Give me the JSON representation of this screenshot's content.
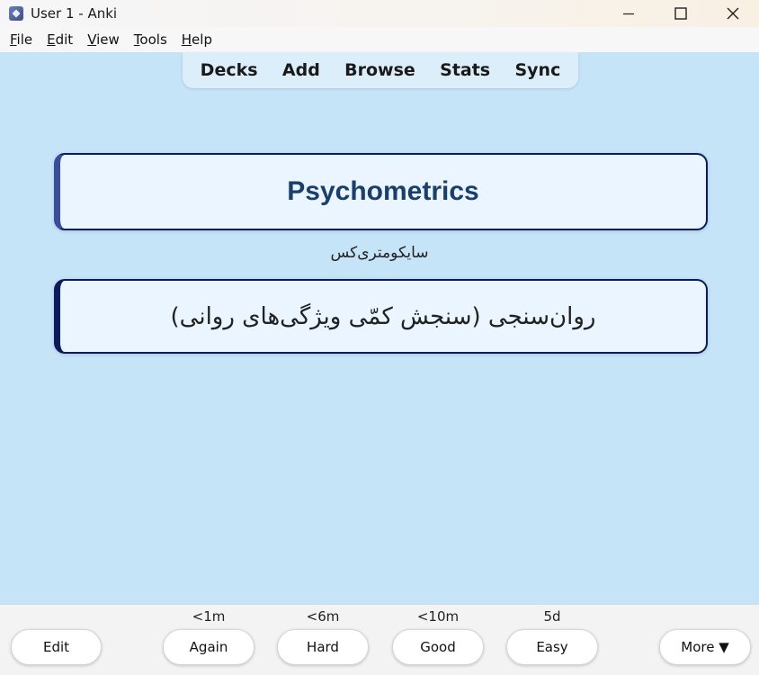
{
  "window": {
    "title": "User 1 - Anki",
    "icon": "anki-star-icon"
  },
  "menu": {
    "items": [
      {
        "label": "File",
        "u": "F",
        "rest": "ile"
      },
      {
        "label": "Edit",
        "u": "E",
        "rest": "dit"
      },
      {
        "label": "View",
        "u": "V",
        "rest": "iew"
      },
      {
        "label": "Tools",
        "u": "T",
        "rest": "ools"
      },
      {
        "label": "Help",
        "u": "H",
        "rest": "elp"
      }
    ]
  },
  "toolbar": {
    "decks": "Decks",
    "add": "Add",
    "browse": "Browse",
    "stats": "Stats",
    "sync": "Sync"
  },
  "card": {
    "front": "Psychometrics",
    "hint": "سایکومتری‌کس",
    "back": "روان‌سنجی (سنجش کمّی ویژگی‌های روانی)"
  },
  "answer": {
    "edit": "Edit",
    "again": {
      "interval": "<1m",
      "label": "Again"
    },
    "hard": {
      "interval": "<6m",
      "label": "Hard"
    },
    "good": {
      "interval": "<10m",
      "label": "Good"
    },
    "easy": {
      "interval": "5d",
      "label": "Easy"
    },
    "more": "More ▼"
  },
  "colors": {
    "background": "#c5e4f8",
    "card_border": "#0d1a5c",
    "front_text": "#1b3f6b"
  }
}
